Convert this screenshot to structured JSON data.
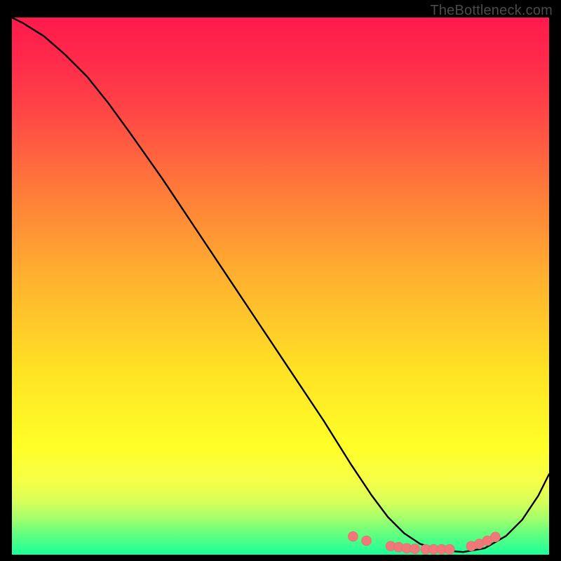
{
  "watermark": "TheBottleneck.com",
  "chart_data": {
    "type": "line",
    "title": "",
    "xlabel": "",
    "ylabel": "",
    "xlim": [
      0,
      100
    ],
    "ylim": [
      0,
      100
    ],
    "background": "rainbow-gradient",
    "series": [
      {
        "name": "curve",
        "x": [
          0,
          2,
          6,
          10,
          14,
          18,
          22,
          28,
          34,
          40,
          46,
          52,
          58,
          63,
          67,
          70,
          73,
          76,
          80,
          84,
          88,
          92,
          95,
          98,
          100
        ],
        "y": [
          100,
          99,
          96.5,
          93,
          89,
          84,
          78.5,
          70,
          61,
          52,
          43,
          34,
          25,
          17,
          11,
          7,
          4,
          2,
          0.8,
          0.5,
          1.2,
          3.5,
          6.5,
          11,
          15
        ]
      }
    ],
    "markers": {
      "name": "dots",
      "x": [
        63.5,
        66,
        70.5,
        72,
        73.5,
        75,
        77,
        78.5,
        80,
        81.5,
        85.5,
        87,
        88.5,
        90
      ],
      "y": [
        3.4,
        2.6,
        1.6,
        1.4,
        1.2,
        1.1,
        1.0,
        1.0,
        1.0,
        1.0,
        1.6,
        2.0,
        2.6,
        3.3
      ],
      "color": "#f07878",
      "radius": 7
    }
  }
}
